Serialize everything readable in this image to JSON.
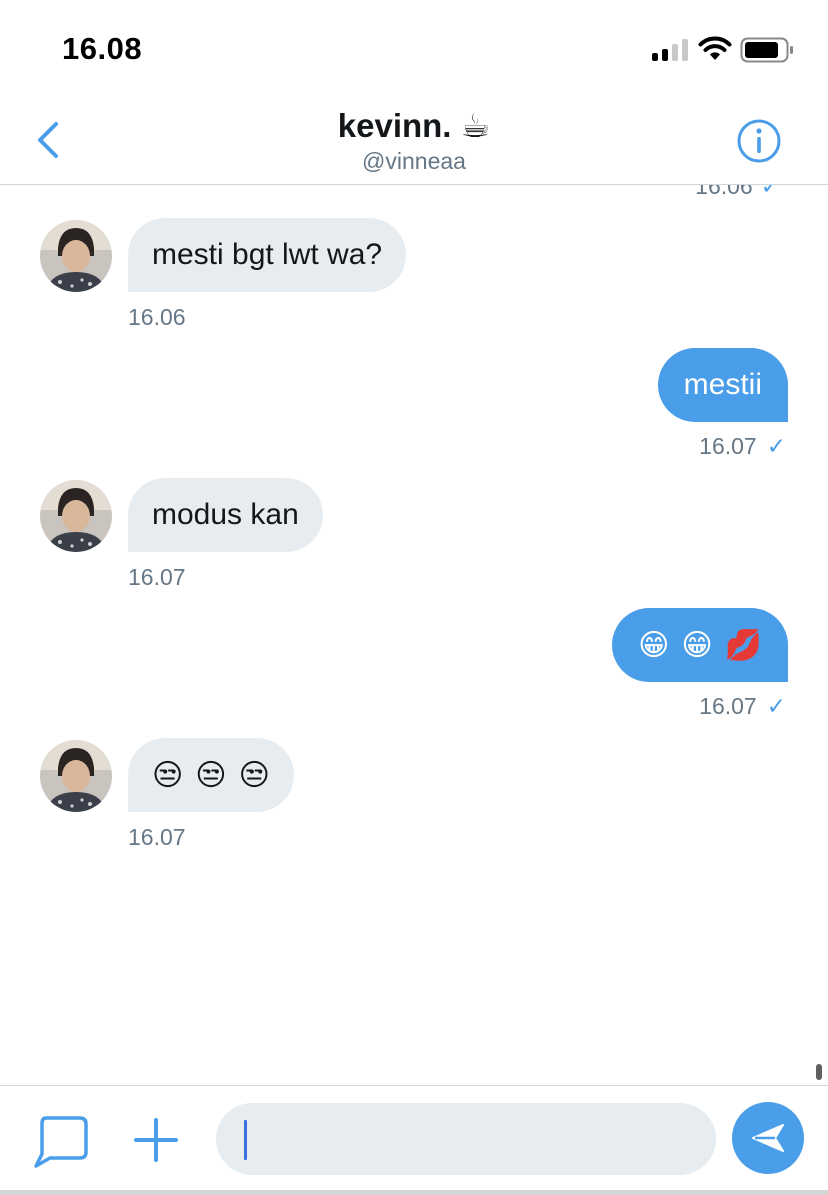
{
  "status_bar": {
    "time": "16.08"
  },
  "header": {
    "title": "kevinn. ☕",
    "subtitle": "@vinneaa"
  },
  "conversation": {
    "cut_off_timestamp": "16.06",
    "messages": [
      {
        "direction": "incoming",
        "text": "mesti bgt lwt wa?",
        "time": "16.06"
      },
      {
        "direction": "outgoing",
        "text": "mestii",
        "time": "16.07",
        "read_mark": "✓"
      },
      {
        "direction": "incoming",
        "text": "modus kan",
        "time": "16.07"
      },
      {
        "direction": "outgoing",
        "emojis": [
          "😁",
          "😁",
          "💋"
        ],
        "time": "16.07",
        "read_mark": "✓"
      },
      {
        "direction": "incoming",
        "emojis": [
          "😒",
          "😒",
          "😒"
        ],
        "time": "16.07"
      }
    ]
  },
  "composer": {
    "input_value": "",
    "placeholder": ""
  },
  "icons": {
    "back": "chevron-left-icon",
    "info": "info-circle-icon",
    "dm": "speech-bubble-icon",
    "add": "plus-icon",
    "send": "paper-plane-icon"
  },
  "colors": {
    "accent": "#4a9de8",
    "incoming_bubble": "#e6ecf0",
    "secondary_text": "#657786",
    "divider": "#cfd6dc"
  }
}
